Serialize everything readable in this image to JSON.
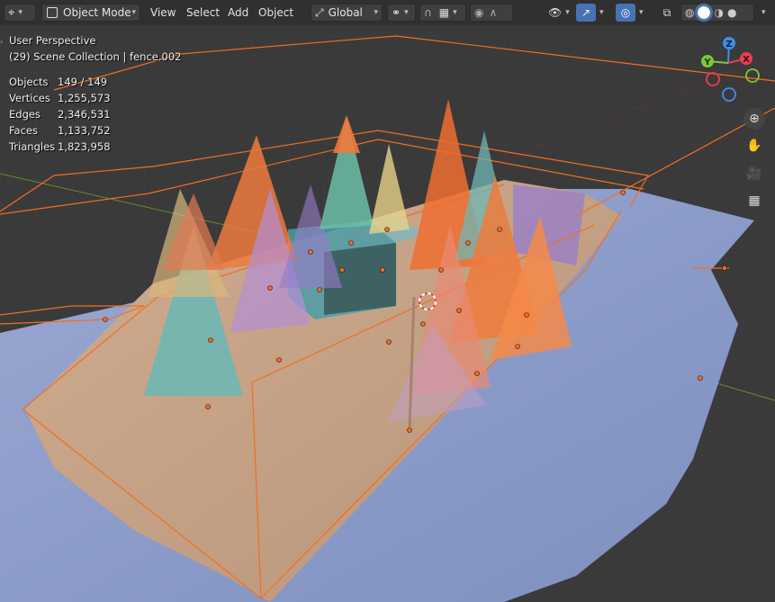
{
  "header": {
    "editor_type_icon": "axis-icon",
    "mode_label": "Object Mode",
    "menus": [
      "View",
      "Select",
      "Add",
      "Object"
    ],
    "transform_orientation": "Global",
    "pivot_icon": "pivot-icon",
    "snap_icon": "magnet-icon",
    "snap_target_icon": "grid-snap-icon",
    "proportional_icon": "proportional-circle-icon",
    "falloff_icon": "falloff-curve-icon",
    "visibility_icon": "eye-icon",
    "gizmo_icon": "gizmo-arrow-icon",
    "overlay_icon": "overlay-circles-icon",
    "xray_icon": "xray-icon",
    "shading_modes": [
      "wireframe",
      "solid",
      "material",
      "rendered"
    ],
    "active_shading": "solid"
  },
  "overlay": {
    "perspective": "User Perspective",
    "collection": "(29) Scene Collection | fence.002",
    "stats": [
      {
        "label": "Objects",
        "value": "149 / 149"
      },
      {
        "label": "Vertices",
        "value": "1,255,573"
      },
      {
        "label": "Edges",
        "value": "2,346,531"
      },
      {
        "label": "Faces",
        "value": "1,133,752"
      },
      {
        "label": "Triangles",
        "value": "1,823,958"
      }
    ]
  },
  "gizmo": {
    "x": "X",
    "y": "Y",
    "z": "Z"
  },
  "nav_buttons": [
    "zoom-icon",
    "hand-pan-icon",
    "camera-icon",
    "perspective-grid-icon"
  ],
  "colors": {
    "selection_orange": "#f26d22",
    "terrain_blue": "#8b9bc9",
    "sand": "#c9a587",
    "accent_blue": "#4772b3",
    "axis_x": "#e8404f",
    "axis_y": "#7ec63c",
    "axis_z": "#3d8fe8"
  }
}
